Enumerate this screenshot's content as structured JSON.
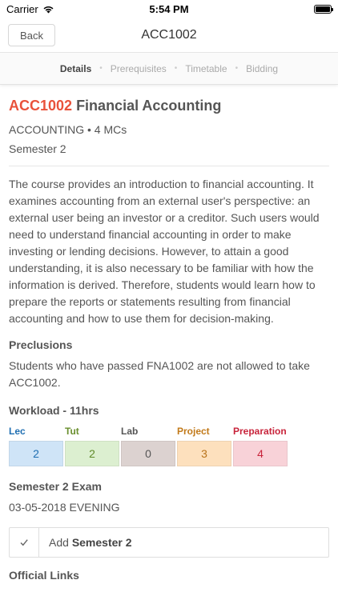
{
  "status_bar": {
    "carrier": "Carrier",
    "time": "5:54 PM",
    "battery_level": 1.0
  },
  "nav": {
    "back_label": "Back",
    "title": "ACC1002"
  },
  "tabs": [
    {
      "label": "Details",
      "active": true
    },
    {
      "label": "Prerequisites",
      "active": false
    },
    {
      "label": "Timetable",
      "active": false
    },
    {
      "label": "Bidding",
      "active": false
    }
  ],
  "module": {
    "code": "ACC1002",
    "name": "Financial Accounting",
    "department_credits": "ACCOUNTING • 4 MCs",
    "semester": "Semester 2",
    "description": "The course provides an introduction to financial accounting. It examines accounting from an external user's perspective: an external user being an investor or a creditor. Such users would need to understand financial accounting in order to make investing or lending decisions. However, to attain a good understanding, it is also necessary to be familiar with how the information is derived. Therefore, students would learn how to prepare the reports or statements resulting from financial accounting and how to use them for decision-making."
  },
  "preclusions": {
    "heading": "Preclusions",
    "text": "Students who have passed FNA1002 are not allowed to take ACC1002."
  },
  "workload": {
    "heading": "Workload - 11hrs",
    "items": [
      {
        "label": "Lec",
        "value": "2",
        "label_color": "#1f6fb2",
        "text_color": "#1f6fb2",
        "bg": "#cfe4f7"
      },
      {
        "label": "Tut",
        "value": "2",
        "label_color": "#6a8f2e",
        "text_color": "#5f8a2a",
        "bg": "#dcefd0"
      },
      {
        "label": "Lab",
        "value": "0",
        "label_color": "#555555",
        "text_color": "#555555",
        "bg": "#dcd2d0"
      },
      {
        "label": "Project",
        "value": "3",
        "label_color": "#c27a1a",
        "text_color": "#b8731a",
        "bg": "#fde0bd"
      },
      {
        "label": "Preparation",
        "value": "4",
        "label_color": "#c8243b",
        "text_color": "#c8243b",
        "bg": "#f8d2d8"
      }
    ]
  },
  "exam": {
    "heading": "Semester 2 Exam",
    "date": "03-05-2018 EVENING"
  },
  "add_button": {
    "prefix": "Add",
    "semester": "Semester 2"
  },
  "next_section": {
    "heading": "Official Links"
  }
}
